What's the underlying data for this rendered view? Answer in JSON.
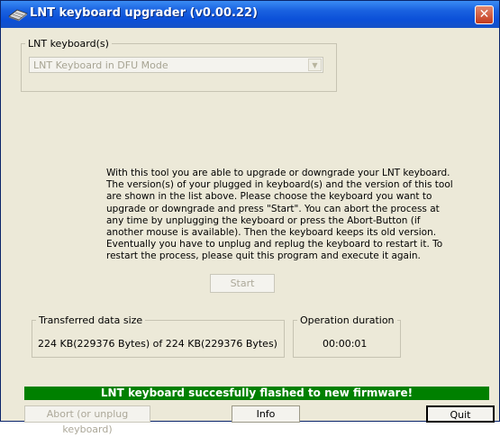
{
  "window": {
    "title": "LNT keyboard upgrader (v0.00.22)",
    "close_glyph": "✕"
  },
  "keyboard_group": {
    "legend": "LNT keyboard(s)",
    "dropdown_value": "LNT Keyboard in DFU Mode",
    "dropdown_arrow": "▼"
  },
  "instructions": "With this tool you are able to upgrade or downgrade your LNT keyboard. The version(s) of your plugged in keyboard(s) and the version of this tool are shown in the list above. Please choose the keyboard you want to upgrade or downgrade and press \"Start\". You can abort the process at any time by unplugging the keyboard or press the Abort-Button (if another mouse is available). Then the keyboard keeps its old version. Eventually you have to unplug and replug the keyboard to restart it. To restart the process, please quit this program and execute it again.",
  "start_button": "Start",
  "transfer_group": {
    "legend": "Transferred data size",
    "value": "224 KB(229376 Bytes) of 224 KB(229376 Bytes)"
  },
  "duration_group": {
    "legend": "Operation duration",
    "value": "00:00:01"
  },
  "status_message": "LNT keyboard succesfully flashed to new firmware!",
  "buttons": {
    "abort": "Abort (or unplug keyboard)",
    "info": "Info",
    "quit": "Quit"
  },
  "colors": {
    "titlebar": "#0b4fd8",
    "status_bar": "#008000",
    "window_bg": "#ece9d8",
    "close_button": "#c33a1d"
  },
  "icons": [
    "keyboard-icon",
    "close-icon",
    "dropdown-arrow-icon"
  ]
}
